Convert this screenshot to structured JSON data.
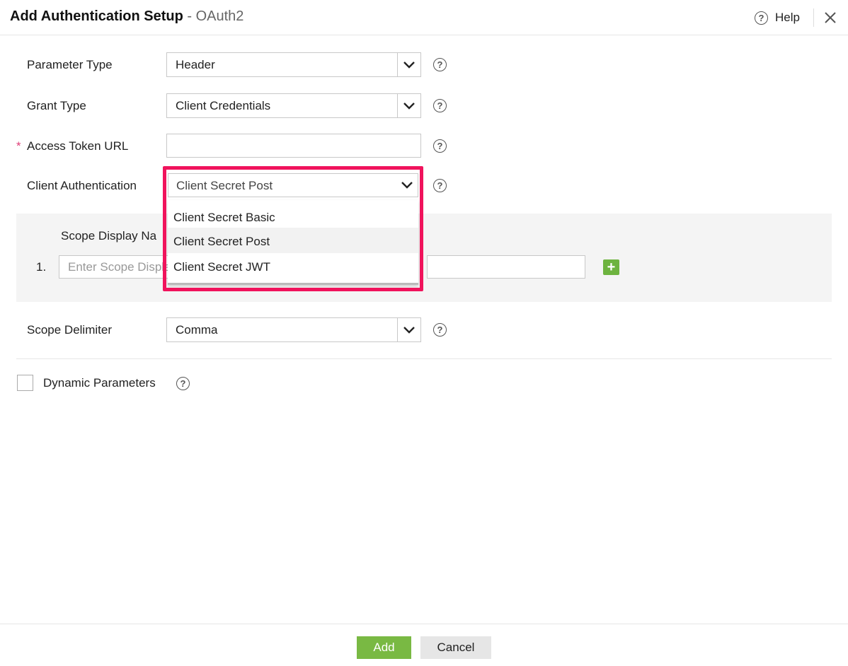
{
  "header": {
    "title": "Add Authentication Setup",
    "separator": " - ",
    "subtitle": "OAuth2",
    "help_label": "Help"
  },
  "form": {
    "parameter_type": {
      "label": "Parameter Type",
      "value": "Header"
    },
    "grant_type": {
      "label": "Grant Type",
      "value": "Client Credentials"
    },
    "access_token_url": {
      "required_mark": "*",
      "label": "Access Token URL",
      "value": ""
    },
    "client_authentication": {
      "label": "Client Authentication",
      "value": "Client Secret Post"
    },
    "scope": {
      "header": "Scope Display Na",
      "row_number": "1.",
      "display_name_placeholder": "Enter Scope Display Name"
    },
    "scope_delimiter": {
      "label": "Scope Delimiter",
      "value": "Comma"
    },
    "dynamic_parameters": {
      "label": "Dynamic Parameters",
      "checked": false
    }
  },
  "dropdown": {
    "options": [
      "Client Secret Basic",
      "Client Secret Post",
      "Client Secret JWT"
    ],
    "hovered": "Client Secret Post"
  },
  "footer": {
    "add_label": "Add",
    "cancel_label": "Cancel"
  },
  "colors": {
    "accent_green": "#79b943",
    "highlight": "#f0135c",
    "required": "#e0407a"
  }
}
